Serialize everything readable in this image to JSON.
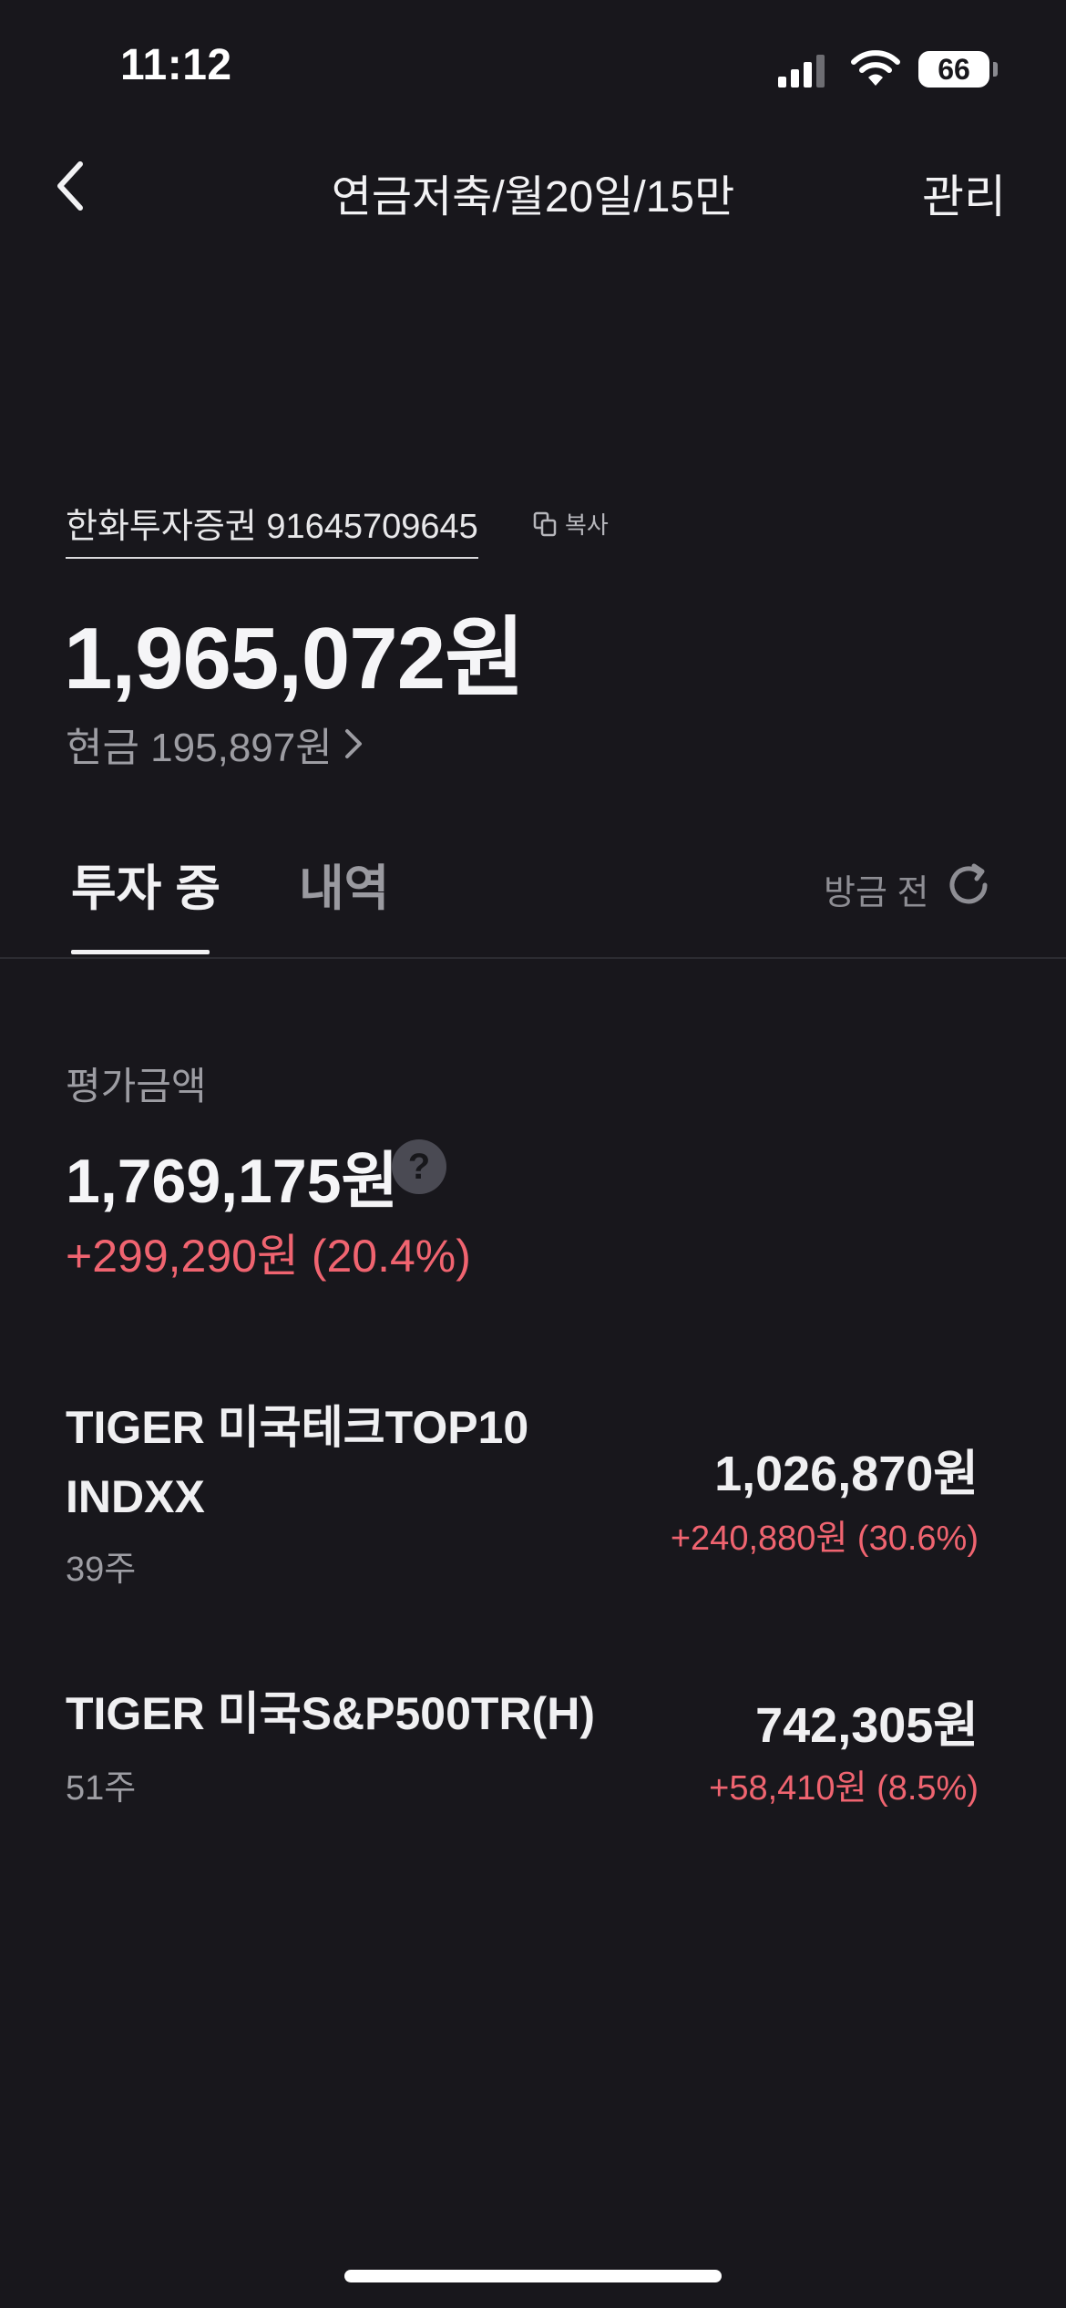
{
  "status_bar": {
    "time": "11:12",
    "battery": "66"
  },
  "header": {
    "title": "연금저축/월20일/15만",
    "manage_label": "관리"
  },
  "account": {
    "label": "한화투자증권 91645709645",
    "copy_label": "복사",
    "total": "1,965,072원",
    "cash": "현금 195,897원"
  },
  "tabs": [
    {
      "label": "투자 중",
      "active": true
    },
    {
      "label": "내역",
      "active": false
    }
  ],
  "refresh": {
    "label": "방금 전"
  },
  "valuation": {
    "label": "평가금액",
    "value": "1,769,175원",
    "help": "?",
    "change": "+299,290원 (20.4%)"
  },
  "holdings": [
    {
      "name_line1": "TIGER 미국테크TOP10",
      "name_line2": "INDXX",
      "qty": "39주",
      "value": "1,026,870원",
      "change": "+240,880원 (30.6%)"
    },
    {
      "name_line1": "TIGER 미국S&P500TR(H)",
      "qty": "51주",
      "value": "742,305원",
      "change": "+58,410원 (8.5%)"
    }
  ],
  "colors": {
    "background": "#18171c",
    "positive": "#f06470",
    "muted": "#9d9da3"
  }
}
